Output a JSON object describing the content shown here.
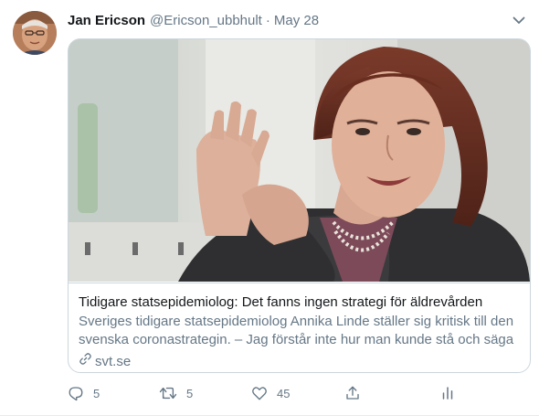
{
  "tweet": {
    "author_name": "Jan Ericson",
    "author_handle": "@Ericson_ubbhult",
    "separator": "·",
    "date": "May 28"
  },
  "card": {
    "title": "Tidigare statsepidemiolog: Det fanns ingen strategi för äldrevården",
    "description": "Sveriges tidigare statsepidemiolog Annika Linde ställer sig kritisk till den svenska coronastrategin. – Jag förstår inte hur man kunde stå och säga …",
    "domain": "svt.se"
  },
  "actions": {
    "reply_count": "5",
    "retweet_count": "5",
    "like_count": "45"
  },
  "colors": {
    "text_primary": "#14171a",
    "text_secondary": "#657786",
    "border": "#ccd6dd"
  },
  "icons": [
    "chevron-down-icon",
    "link-icon",
    "reply-icon",
    "retweet-icon",
    "like-icon",
    "share-icon",
    "analytics-icon"
  ]
}
